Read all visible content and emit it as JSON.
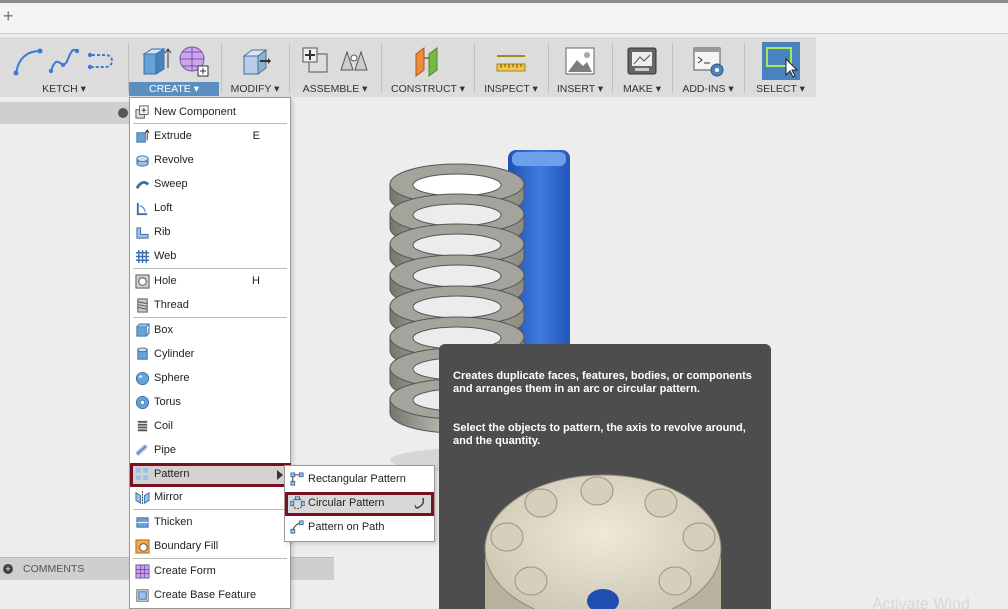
{
  "toolbar": {
    "groups": [
      {
        "label": "KETCH ▾",
        "icon": "sketch-icons"
      },
      {
        "label": "CREATE ▾",
        "icon": "create-icons",
        "active": true
      },
      {
        "label": "MODIFY ▾",
        "icon": "modify-icon"
      },
      {
        "label": "ASSEMBLE ▾",
        "icon": "assemble-icons"
      },
      {
        "label": "CONSTRUCT ▾",
        "icon": "construct-icon"
      },
      {
        "label": "INSPECT ▾",
        "icon": "inspect-icon"
      },
      {
        "label": "INSERT ▾",
        "icon": "insert-icon"
      },
      {
        "label": "MAKE ▾",
        "icon": "make-icon"
      },
      {
        "label": "ADD-INS ▾",
        "icon": "addins-icon"
      },
      {
        "label": "SELECT ▾",
        "icon": "select-icon"
      }
    ]
  },
  "create_menu": {
    "items": [
      {
        "label": "New Component",
        "shortcut": "",
        "icon": "new-component-icon"
      },
      {
        "label": "Extrude",
        "shortcut": "E",
        "icon": "extrude-icon"
      },
      {
        "label": "Revolve",
        "shortcut": "",
        "icon": "revolve-icon"
      },
      {
        "label": "Sweep",
        "shortcut": "",
        "icon": "sweep-icon"
      },
      {
        "label": "Loft",
        "shortcut": "",
        "icon": "loft-icon"
      },
      {
        "label": "Rib",
        "shortcut": "",
        "icon": "rib-icon"
      },
      {
        "label": "Web",
        "shortcut": "",
        "icon": "web-icon"
      },
      {
        "label": "Hole",
        "shortcut": "H",
        "icon": "hole-icon"
      },
      {
        "label": "Thread",
        "shortcut": "",
        "icon": "thread-icon"
      },
      {
        "label": "Box",
        "shortcut": "",
        "icon": "box-icon"
      },
      {
        "label": "Cylinder",
        "shortcut": "",
        "icon": "cylinder-icon"
      },
      {
        "label": "Sphere",
        "shortcut": "",
        "icon": "sphere-icon"
      },
      {
        "label": "Torus",
        "shortcut": "",
        "icon": "torus-icon"
      },
      {
        "label": "Coil",
        "shortcut": "",
        "icon": "coil-icon"
      },
      {
        "label": "Pipe",
        "shortcut": "",
        "icon": "pipe-icon"
      },
      {
        "label": "Pattern",
        "shortcut": "",
        "icon": "pattern-icon"
      },
      {
        "label": "Mirror",
        "shortcut": "",
        "icon": "mirror-icon"
      },
      {
        "label": "Thicken",
        "shortcut": "",
        "icon": "thicken-icon"
      },
      {
        "label": "Boundary Fill",
        "shortcut": "",
        "icon": "boundary-fill-icon"
      },
      {
        "label": "Create Form",
        "shortcut": "",
        "icon": "create-form-icon"
      },
      {
        "label": "Create Base Feature",
        "shortcut": "",
        "icon": "base-feature-icon"
      }
    ]
  },
  "pattern_submenu": {
    "items": [
      {
        "label": "Rectangular Pattern",
        "icon": "rectangular-pattern-icon"
      },
      {
        "label": "Circular Pattern",
        "icon": "circular-pattern-icon"
      },
      {
        "label": "Pattern on Path",
        "icon": "pattern-on-path-icon"
      }
    ]
  },
  "tooltip": {
    "para1": "Creates duplicate faces, features, bodies, or components and arranges them in an arc or circular pattern.",
    "para2": "Select the objects to pattern, the axis to revolve around, and the quantity."
  },
  "browser": {
    "comments_label": "COMMENTS"
  },
  "watermark": "Activate Wind",
  "colors": {
    "highlight_outline": "#7a1020",
    "create_tab": "#5a8fbf",
    "coil_blue": "#2f63c8",
    "coil_grey": "#9a9a92",
    "tooltip_bg": "#4d4d4d"
  }
}
